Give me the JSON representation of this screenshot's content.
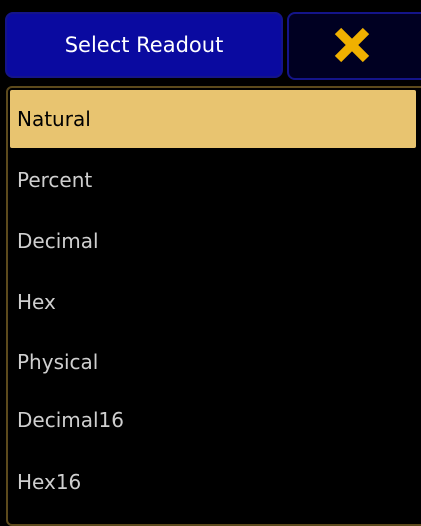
{
  "dialog": {
    "title": "Select Readout",
    "close_icon": "close-x-icon"
  },
  "colors": {
    "title_bg": "#0a0aa0",
    "frame_border": "#5c4a1c",
    "selected_bg": "#e8c470",
    "close_icon": "#f0b000"
  },
  "readouts": [
    {
      "label": "Natural",
      "selected": true
    },
    {
      "label": "Percent",
      "selected": false
    },
    {
      "label": "Decimal",
      "selected": false
    },
    {
      "label": "Hex",
      "selected": false
    },
    {
      "label": "Physical",
      "selected": false
    },
    {
      "label": "Decimal16",
      "selected": false
    },
    {
      "label": "Hex16",
      "selected": false
    }
  ]
}
